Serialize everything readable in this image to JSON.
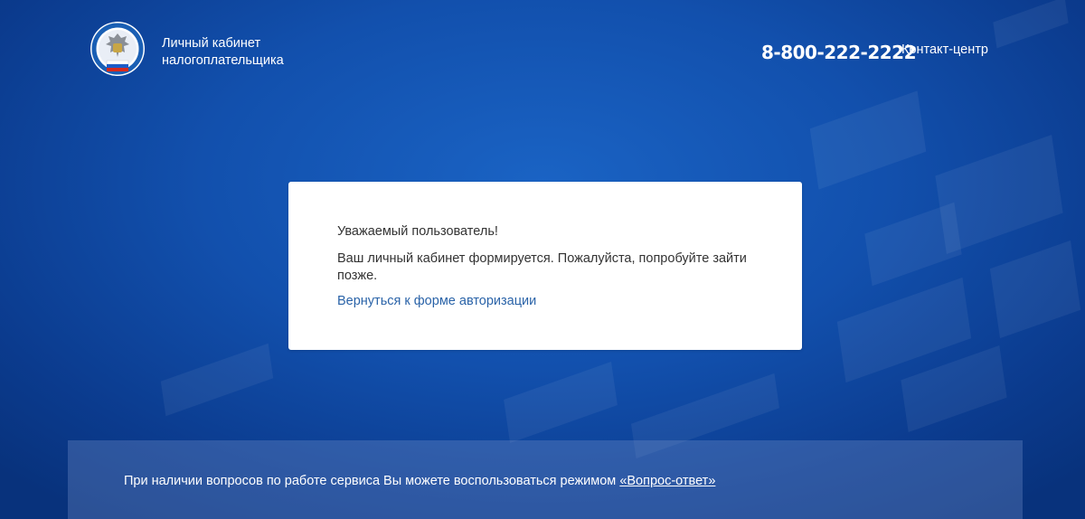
{
  "header": {
    "brand_line1": "Личный кабинет",
    "brand_line2": "налогоплательщика",
    "phone": "8-800-222-2222",
    "contact_label": "Контакт-центр"
  },
  "message": {
    "greeting": "Уважаемый пользователь!",
    "body": "Ваш личный кабинет формируется. Пожалуйста, попробуйте зайти позже.",
    "back_link": "Вернуться к форме авторизации"
  },
  "footer": {
    "text": "При наличии вопросов по работе сервиса Вы можете воспользоваться режимом",
    "link": "«Вопрос-ответ»"
  },
  "colors": {
    "background": "#1250ad",
    "link": "#2a63a8",
    "card": "#ffffff"
  },
  "icons": {
    "logo": "fns-emblem-icon"
  }
}
